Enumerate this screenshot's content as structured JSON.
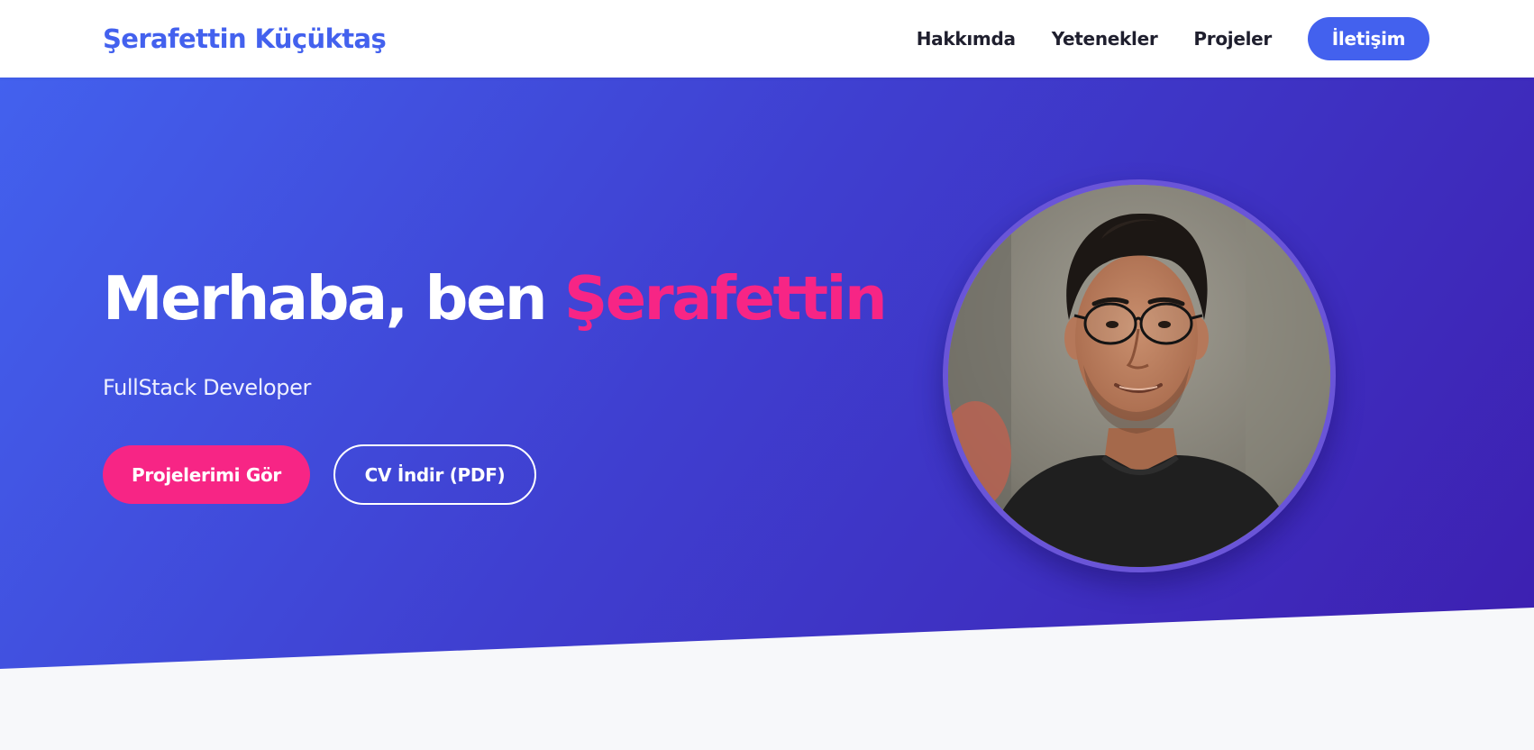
{
  "brand": {
    "name": "Şerafettin Küçüktaş"
  },
  "nav": {
    "links": [
      "Hakkımda",
      "Yetenekler",
      "Projeler"
    ],
    "cta": "İletişim"
  },
  "hero": {
    "greeting": "Merhaba, ben ",
    "name": "Şerafettin",
    "subtitle": "FullStack Developer",
    "primary_button": "Projelerimi Gör",
    "secondary_button": "CV İndir (PDF)"
  },
  "colors": {
    "accent": "#4361ee",
    "pink": "#f72585",
    "hero_start": "#4361ee",
    "hero_end": "#3d1fb0",
    "page_bg": "#f7f8fa"
  }
}
